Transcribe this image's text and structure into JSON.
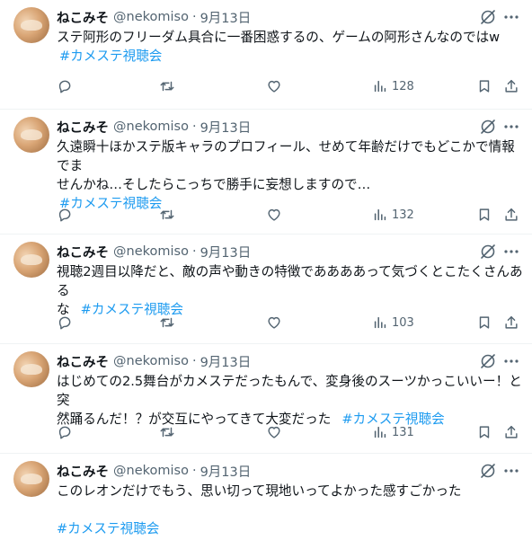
{
  "icons": {
    "reply": "reply-icon",
    "retweet": "retweet-icon",
    "like": "heart-icon",
    "views": "views-chart-icon",
    "bookmark": "bookmark-icon",
    "share": "share-icon",
    "grok": "grok-icon",
    "more": "more-icon"
  },
  "colors": {
    "text": "#0f1419",
    "muted": "#536471",
    "hashtag": "#1d9bf0",
    "divider": "#eff3f4"
  },
  "tweets": [
    {
      "name": "ねこみそ",
      "handle": "@nekomiso",
      "dot": "·",
      "date": "9月13日",
      "lines": [
        "ステ阿形のフリーダム具合に一番困惑するの、ゲームの阿形さんなのではw"
      ],
      "hashtag": "#カメステ視聴会",
      "views": "128"
    },
    {
      "name": "ねこみそ",
      "handle": "@nekomiso",
      "dot": "·",
      "date": "9月13日",
      "lines": [
        "久遠瞬十ほかステ版キャラのプロフィール、せめて年齢だけでもどこかで情報でま",
        "せんかね…そしたらこっちで勝手に妄想しますので…"
      ],
      "hashtag": "#カメステ視聴会",
      "views": "132"
    },
    {
      "name": "ねこみそ",
      "handle": "@nekomiso",
      "dot": "·",
      "date": "9月13日",
      "lines": [
        "視聴2週目以降だと、敵の声や動きの特徴でああああって気づくとこたくさんある",
        "な"
      ],
      "hashtag": "#カメステ視聴会",
      "views": "103"
    },
    {
      "name": "ねこみそ",
      "handle": "@nekomiso",
      "dot": "·",
      "date": "9月13日",
      "lines": [
        "はじめての2.5舞台がカメステだったもんで、変身後のスーツかっこいいー！と突",
        "然踊るんだ！？が交互にやってきて大変だった"
      ],
      "hashtag": "#カメステ視聴会",
      "views": "131"
    },
    {
      "name": "ねこみそ",
      "handle": "@nekomiso",
      "dot": "·",
      "date": "9月13日",
      "lines": [
        "このレオンだけでもう、思い切って現地いってよかった感すごかった",
        ""
      ],
      "hashtag": "#カメステ視聴会",
      "views": ""
    }
  ]
}
